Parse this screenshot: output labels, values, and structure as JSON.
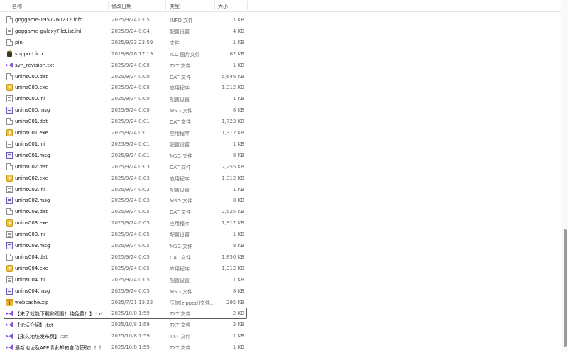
{
  "columns": {
    "name": "名称",
    "date": "修改日期",
    "type": "类型",
    "size": "大小"
  },
  "rows": [
    {
      "icon": "doc",
      "name": "goggame-1957260232.info",
      "date": "2025/9/24 0:05",
      "type": "INFO 文件",
      "size": "1 KB"
    },
    {
      "icon": "ini",
      "name": "goggame-galaxyFileList.ini",
      "date": "2025/9/24 0:04",
      "type": "配置设置",
      "size": "4 KB"
    },
    {
      "icon": "doc",
      "name": "pin",
      "date": "2025/9/23 23:59",
      "type": "文件",
      "size": "1 KB"
    },
    {
      "icon": "ico",
      "name": "support.ico",
      "date": "2019/8/26 17:19",
      "type": "ICO 图片文件",
      "size": "62 KB"
    },
    {
      "icon": "vs",
      "name": "svn_revision.txt",
      "date": "2025/9/24 0:00",
      "type": "TXT 文件",
      "size": "1 KB"
    },
    {
      "icon": "doc",
      "name": "unins000.dat",
      "date": "2025/9/24 0:00",
      "type": "DAT 文件",
      "size": "5,646 KB"
    },
    {
      "icon": "exe",
      "name": "unins000.exe",
      "date": "2025/9/24 0:00",
      "type": "应用程序",
      "size": "1,312 KB"
    },
    {
      "icon": "ini",
      "name": "unins000.ini",
      "date": "2025/9/24 0:00",
      "type": "配置设置",
      "size": "1 KB"
    },
    {
      "icon": "msg",
      "name": "unins000.msg",
      "date": "2025/9/24 0:00",
      "type": "MSG 文件",
      "size": "8 KB"
    },
    {
      "icon": "doc",
      "name": "unins001.dat",
      "date": "2025/9/24 0:01",
      "type": "DAT 文件",
      "size": "1,723 KB"
    },
    {
      "icon": "exe",
      "name": "unins001.exe",
      "date": "2025/9/24 0:01",
      "type": "应用程序",
      "size": "1,312 KB"
    },
    {
      "icon": "ini",
      "name": "unins001.ini",
      "date": "2025/9/24 0:01",
      "type": "配置设置",
      "size": "1 KB"
    },
    {
      "icon": "msg",
      "name": "unins001.msg",
      "date": "2025/9/24 0:01",
      "type": "MSG 文件",
      "size": "8 KB"
    },
    {
      "icon": "doc",
      "name": "unins002.dat",
      "date": "2025/9/24 0:03",
      "type": "DAT 文件",
      "size": "2,255 KB"
    },
    {
      "icon": "exe",
      "name": "unins002.exe",
      "date": "2025/9/24 0:03",
      "type": "应用程序",
      "size": "1,312 KB"
    },
    {
      "icon": "ini",
      "name": "unins002.ini",
      "date": "2025/9/24 0:03",
      "type": "配置设置",
      "size": "1 KB"
    },
    {
      "icon": "msg",
      "name": "unins002.msg",
      "date": "2025/9/24 0:03",
      "type": "MSG 文件",
      "size": "8 KB"
    },
    {
      "icon": "doc",
      "name": "unins003.dat",
      "date": "2025/9/24 0:05",
      "type": "DAT 文件",
      "size": "2,525 KB"
    },
    {
      "icon": "exe",
      "name": "unins003.exe",
      "date": "2025/9/24 0:05",
      "type": "应用程序",
      "size": "1,312 KB"
    },
    {
      "icon": "ini",
      "name": "unins003.ini",
      "date": "2025/9/24 0:05",
      "type": "配置设置",
      "size": "1 KB"
    },
    {
      "icon": "msg",
      "name": "unins003.msg",
      "date": "2025/9/24 0:05",
      "type": "MSG 文件",
      "size": "8 KB"
    },
    {
      "icon": "doc",
      "name": "unins004.dat",
      "date": "2025/9/24 0:05",
      "type": "DAT 文件",
      "size": "1,850 KB"
    },
    {
      "icon": "exe",
      "name": "unins004.exe",
      "date": "2025/9/24 0:05",
      "type": "应用程序",
      "size": "1,312 KB"
    },
    {
      "icon": "ini",
      "name": "unins004.ini",
      "date": "2025/9/24 0:05",
      "type": "配置设置",
      "size": "1 KB"
    },
    {
      "icon": "msg",
      "name": "unins004.msg",
      "date": "2025/9/24 0:05",
      "type": "MSG 文件",
      "size": "8 KB"
    },
    {
      "icon": "zip",
      "name": "webcache.zip",
      "date": "2025/7/21 13:22",
      "type": "压缩(zipped)文件...",
      "size": "295 KB"
    },
    {
      "icon": "vs",
      "name": "【来了就能下载和观看！纯免费！】.txt",
      "date": "2025/10/8 1:59",
      "type": "TXT 文件",
      "size": "2 KB",
      "selected": true
    },
    {
      "icon": "vs",
      "name": "【论坛介绍】.txt",
      "date": "2025/10/8 1:59",
      "type": "TXT 文件",
      "size": "2 KB"
    },
    {
      "icon": "vs",
      "name": "【永久地址发布页】.txt",
      "date": "2025/10/8 1:59",
      "type": "TXT 文件",
      "size": "1 KB"
    },
    {
      "icon": "vs",
      "name": "最新地址及APP请发邮箱自动获取！！！...",
      "date": "2025/10/8 1:59",
      "type": "TXT 文件",
      "size": "1 KB"
    }
  ]
}
